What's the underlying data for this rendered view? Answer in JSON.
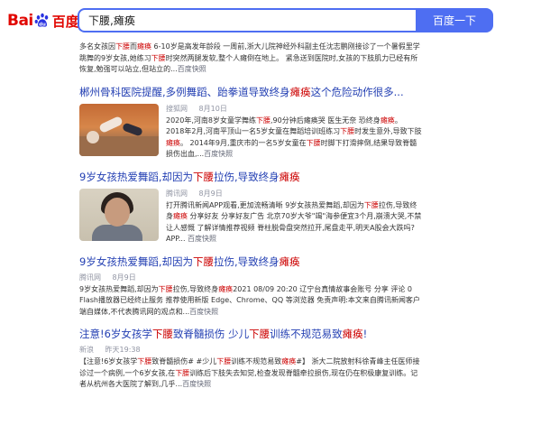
{
  "search": {
    "query": "下腰,瘫痪",
    "button_label": "百度一下"
  },
  "logo": {
    "bai": "Bai",
    "du": "百度"
  },
  "top_snippet": {
    "parts": [
      {
        "t": "多名女孩因"
      },
      {
        "t": "下腰",
        "h": true
      },
      {
        "t": "而"
      },
      {
        "t": "瘫痪",
        "h": true
      },
      {
        "t": " 6-10岁是高发年龄段 一周前,浙大儿院神经外科副主任沈志鹏刚接诊了一个暑假里学跳舞的9岁女孩,她练习"
      },
      {
        "t": "下腰",
        "h": true
      },
      {
        "t": "时突然两腿发软,整个人瘫倒在地上。 紧急送到医院时,女孩的下肢肌力已经有所恢复,勉强可以站立,但站立的..."
      }
    ],
    "snapshot": "百度快照"
  },
  "results": [
    {
      "title_parts": [
        {
          "t": "郴州骨科医院提醒,多例舞蹈、跆拳道导致终身"
        },
        {
          "t": "瘫痪",
          "h": true
        },
        {
          "t": "这个危险动作很多..."
        }
      ],
      "source": "搜狐网",
      "date": "8月10日",
      "abstract_parts": [
        {
          "t": "2020年,河南8岁女童学舞练"
        },
        {
          "t": "下腰",
          "h": true
        },
        {
          "t": ",90分钟后瘫痪哭 医生无奈 恐终身"
        },
        {
          "t": "瘫痪",
          "h": true
        },
        {
          "t": "。 2018年2月,河南平顶山一名5岁女童在舞蹈培训班练习"
        },
        {
          "t": "下腰",
          "h": true
        },
        {
          "t": "时发生意外,导致下肢"
        },
        {
          "t": "瘫痪",
          "h": true
        },
        {
          "t": "。 2014年9月,重庆市的一名5岁女童在"
        },
        {
          "t": "下腰",
          "h": true
        },
        {
          "t": "时脚下打滑摔倒,结果导致脊髓损伤出血,..."
        }
      ],
      "snapshot": "百度快照"
    },
    {
      "title_parts": [
        {
          "t": "9岁女孩热爱舞蹈,却因为"
        },
        {
          "t": "下腰",
          "h": true
        },
        {
          "t": "拉伤,导致终身"
        },
        {
          "t": "瘫痪",
          "h": true
        }
      ],
      "source": "腾讯网",
      "date": "8月9日",
      "abstract_parts": [
        {
          "t": "打开腾讯新闻APP观看,更加流畅清晰 9岁女孩热爱舞蹈,却因为"
        },
        {
          "t": "下腰",
          "h": true
        },
        {
          "t": "拉伤,导致终身"
        },
        {
          "t": "瘫痪",
          "h": true
        },
        {
          "t": " 分享好友 分享好友广告 北京70岁大爷\"竭\"海参便宜3个月,崩溃大哭,不禁让人感慨 了解详情推荐视频 脊柱脱骨盘突然拉开,尾盘走平,明天A股会大跌吗? APP... "
        }
      ],
      "snapshot": "百度快照"
    },
    {
      "title_parts": [
        {
          "t": "9岁女孩热爱舞蹈,却因为"
        },
        {
          "t": "下腰",
          "h": true
        },
        {
          "t": "拉伤,导致终身"
        },
        {
          "t": "瘫痪",
          "h": true
        }
      ],
      "source": "腾讯网",
      "date": "8月9日",
      "abstract_parts": [
        {
          "t": "9岁女孩热爱舞蹈,却因为"
        },
        {
          "t": "下腰",
          "h": true
        },
        {
          "t": "拉伤,导致终身"
        },
        {
          "t": "瘫痪",
          "h": true
        },
        {
          "t": "2021 08/09 20:20 辽宁台真情故事会账号 分享 评论 0 Flash播放器已经终止服务 推荐使用新版 Edge、Chrome、QQ 等浏览器 免责声明:本文来自腾讯新闻客户端自媒体,不代表腾讯网的观点和..."
        }
      ],
      "snapshot": "百度快照"
    },
    {
      "title_parts": [
        {
          "t": "注意!6岁女孩学"
        },
        {
          "t": "下腰",
          "h": true
        },
        {
          "t": "致脊髓损伤 少儿"
        },
        {
          "t": "下腰",
          "h": true
        },
        {
          "t": "训练不规范易致"
        },
        {
          "t": "瘫痪",
          "h": true
        },
        {
          "t": "!"
        }
      ],
      "source": "新浪",
      "date": "昨天19:38",
      "abstract_parts": [
        {
          "t": "【注意!6岁女孩学"
        },
        {
          "t": "下腰",
          "h": true
        },
        {
          "t": "致脊髓损伤# #少儿"
        },
        {
          "t": "下腰",
          "h": true
        },
        {
          "t": "训练不规范易致"
        },
        {
          "t": "瘫痪",
          "h": true
        },
        {
          "t": "#】 浙大二院放射科徐青峰主任医师接诊过一个病例,一个6岁女孩,在"
        },
        {
          "t": "下腰",
          "h": true
        },
        {
          "t": "训练后下肢失去知觉,检查发现脊髓牵拉损伤,现在仍在积极康复训练。记者从杭州各大医院了解到,几乎..."
        }
      ],
      "snapshot": "百度快照"
    }
  ]
}
